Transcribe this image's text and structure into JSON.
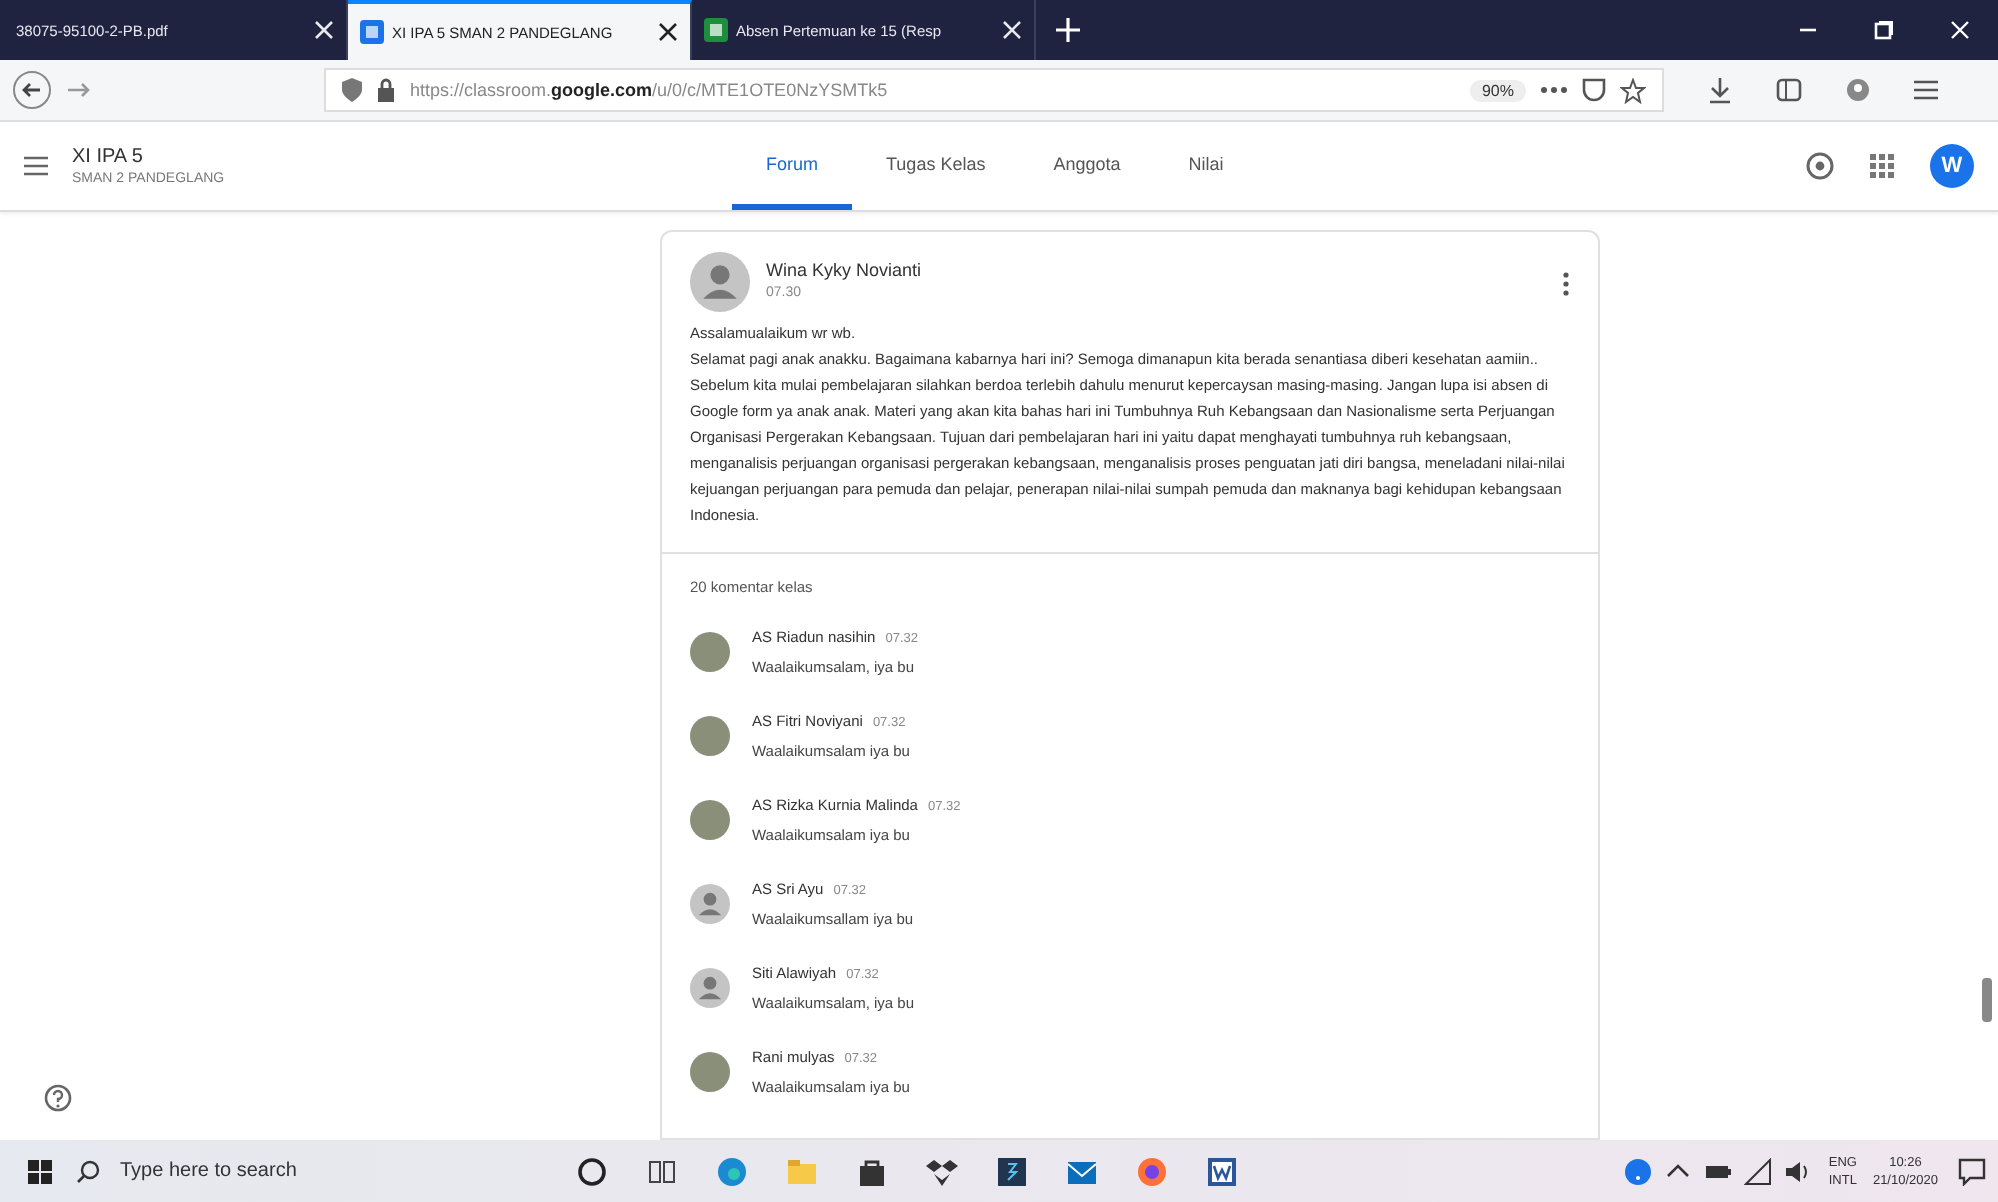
{
  "browser": {
    "tabs": [
      {
        "label": "38075-95100-2-PB.pdf",
        "selected": false
      },
      {
        "label": "XI IPA 5 SMAN 2 PANDEGLANG",
        "selected": true
      },
      {
        "label": "Absen Pertemuan ke 15 (Resp",
        "selected": false
      }
    ],
    "url_prefix": "https://classroom.",
    "url_host": "google.com",
    "url_path": "/u/0/c/MTE1OTE0NzYSMTk5",
    "zoom": "90%"
  },
  "classroom": {
    "title": "XI IPA 5",
    "subtitle": "SMAN 2 PANDEGLANG",
    "avatar_letter": "W",
    "nav": [
      {
        "label": "Forum",
        "selected": true
      },
      {
        "label": "Tugas Kelas",
        "selected": false
      },
      {
        "label": "Anggota",
        "selected": false
      },
      {
        "label": "Nilai",
        "selected": false
      }
    ]
  },
  "post": {
    "author": "Wina Kyky Novianti",
    "time": "07.30",
    "greeting": "Assalamualaikum wr wb.",
    "body": "Selamat pagi anak anakku. Bagaimana kabarnya hari ini? Semoga dimanapun kita berada senantiasa diberi kesehatan aamiin.. Sebelum kita mulai pembelajaran silahkan berdoa terlebih dahulu menurut kepercaysan masing-masing. Jangan lupa isi absen di Google form ya anak anak. Materi yang akan kita bahas hari ini Tumbuhnya Ruh Kebangsaan dan Nasionalisme serta Perjuangan Organisasi Pergerakan Kebangsaan. Tujuan dari pembelajaran hari ini yaitu dapat menghayati tumbuhnya ruh kebangsaan, menganalisis perjuangan organisasi pergerakan kebangsaan, menganalisis proses penguatan jati diri bangsa, meneladani nilai-nilai kejuangan perjuangan para pemuda dan pelajar, penerapan nilai-nilai sumpah pemuda dan maknanya bagi kehidupan kebangsaan Indonesia."
  },
  "comments_header": "20 komentar kelas",
  "comments": [
    {
      "name": "AS Riadun nasihin",
      "time": "07.32",
      "text": "Waalaikumsalam, iya bu",
      "kind": "photo"
    },
    {
      "name": "AS Fitri Noviyani",
      "time": "07.32",
      "text": "Waalaikumsalam iya bu",
      "kind": "photo"
    },
    {
      "name": "AS Rizka Kurnia Malinda",
      "time": "07.32",
      "text": "Waalaikumsalam iya bu",
      "kind": "photo"
    },
    {
      "name": "AS Sri Ayu",
      "time": "07.32",
      "text": "Waalaikumsallam iya bu",
      "kind": "default"
    },
    {
      "name": "Siti Alawiyah",
      "time": "07.32",
      "text": "Waalaikumsalam, iya bu",
      "kind": "default"
    },
    {
      "name": "Rani mulyas",
      "time": "07.32",
      "text": "Waalaikumsalam iya bu",
      "kind": "photo"
    }
  ],
  "taskbar": {
    "search_placeholder": "Type here to search",
    "lang_top": "ENG",
    "lang_bottom": "INTL",
    "time": "10:26",
    "date": "21/10/2020"
  }
}
